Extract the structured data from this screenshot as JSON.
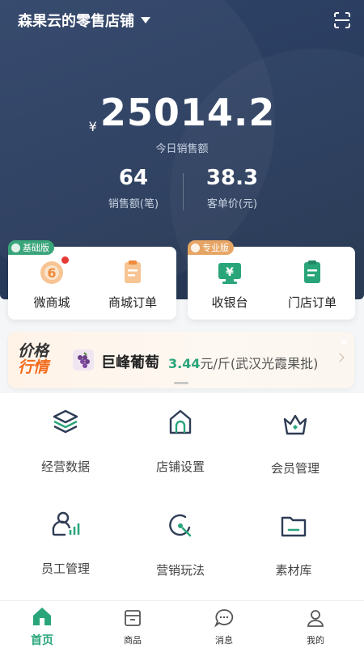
{
  "header": {
    "store_name": "森果云的零售店铺"
  },
  "sales": {
    "currency": "¥",
    "amount": "25014.2",
    "amount_label": "今日销售额",
    "count": "64",
    "count_label": "销售额(笔)",
    "avg": "38.3",
    "avg_label": "客单价(元)"
  },
  "cards": {
    "basic_badge": "基础版",
    "pro_badge": "专业版",
    "items": [
      {
        "label": "微商城",
        "icon": "mall-icon"
      },
      {
        "label": "商城订单",
        "icon": "order-icon"
      },
      {
        "label": "收银台",
        "icon": "cashier-icon"
      },
      {
        "label": "门店订单",
        "icon": "store-order-icon"
      }
    ]
  },
  "price_banner": {
    "tag_line1": "价格",
    "tag_line2": "行情",
    "product": "巨峰葡萄",
    "price": "3.44",
    "unit_source": "元/斤(武汉光霞果批)"
  },
  "grid": [
    {
      "label": "经营数据",
      "icon": "layers-icon"
    },
    {
      "label": "店铺设置",
      "icon": "store-icon"
    },
    {
      "label": "会员管理",
      "icon": "crown-icon"
    },
    {
      "label": "员工管理",
      "icon": "staff-icon"
    },
    {
      "label": "营销玩法",
      "icon": "marketing-icon"
    },
    {
      "label": "素材库",
      "icon": "folder-icon"
    }
  ],
  "tabs": [
    {
      "label": "首页",
      "active": true
    },
    {
      "label": "商品",
      "active": false
    },
    {
      "label": "消息",
      "active": false
    },
    {
      "label": "我的",
      "active": false
    }
  ],
  "colors": {
    "hero_bg": "#2f4469",
    "accent_green": "#2aa57a",
    "accent_orange": "#f26b1d"
  }
}
